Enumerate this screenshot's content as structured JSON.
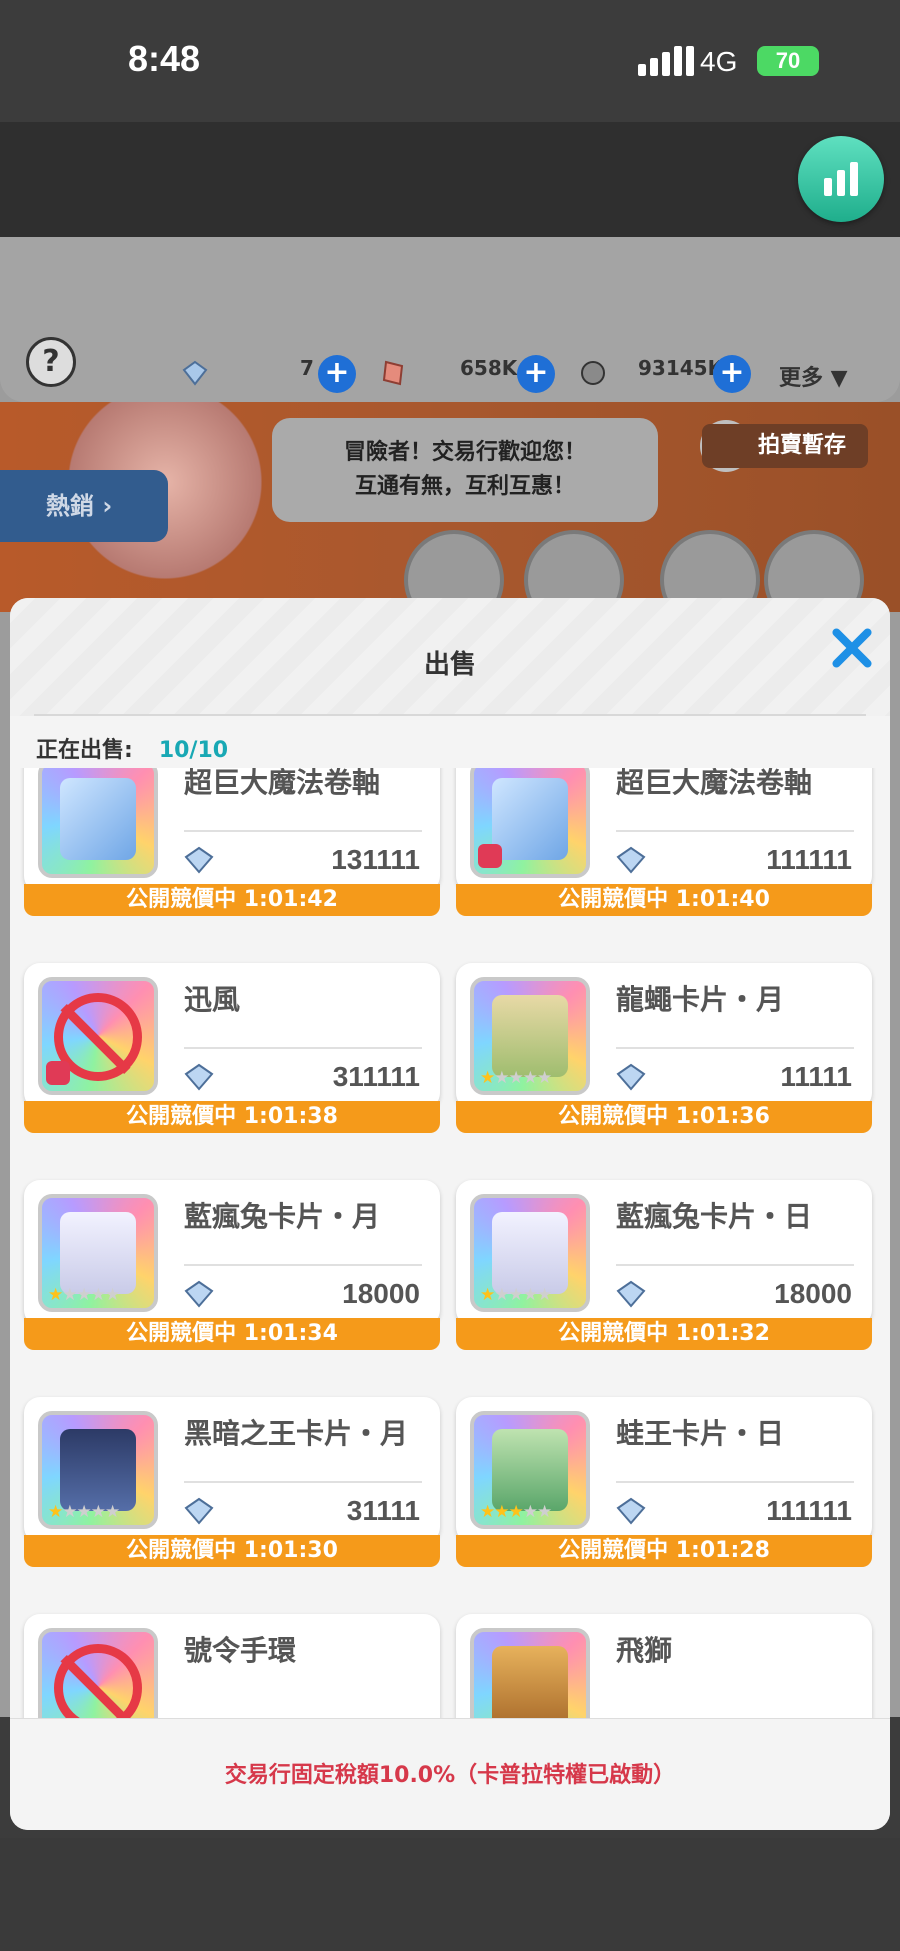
{
  "status_bar": {
    "time": "8:48",
    "network": "4G",
    "battery": "70"
  },
  "currency": {
    "gem_count": "7",
    "crystal_count": "658K",
    "zeny_count": "93145K",
    "more_label": "更多"
  },
  "npc": {
    "speech": "冒險者！交易行歡迎您！\n互通有無，互利互惠！"
  },
  "auction_label": "拍賣暫存",
  "hot_label": "熱銷",
  "modal": {
    "title": "出售",
    "selling_label": "正在出售:",
    "selling_count": "10/10",
    "tax_notice": "交易行固定稅額10.0%（卡普拉特權已啟動）"
  },
  "items": [
    {
      "name": "超巨大魔法卷軸",
      "price": "131111",
      "status": "公開競價中 1:01:42",
      "locked": false,
      "stars": 0,
      "art": "scroll"
    },
    {
      "name": "超巨大魔法卷軸",
      "price": "111111",
      "status": "公開競價中 1:01:40",
      "locked": true,
      "stars": 0,
      "art": "scroll"
    },
    {
      "name": "迅風",
      "price": "311111",
      "status": "公開競價中 1:01:38",
      "locked": true,
      "stars": 0,
      "art": "forbidden"
    },
    {
      "name": "龍蠅卡片・月",
      "price": "11111",
      "status": "公開競價中 1:01:36",
      "locked": false,
      "stars": 1,
      "art": "card-fly"
    },
    {
      "name": "藍瘋兔卡片・月",
      "price": "18000",
      "status": "公開競價中 1:01:34",
      "locked": false,
      "stars": 1,
      "art": "card-rabbit"
    },
    {
      "name": "藍瘋兔卡片・日",
      "price": "18000",
      "status": "公開競價中 1:01:32",
      "locked": false,
      "stars": 1,
      "art": "card-rabbit"
    },
    {
      "name": "黑暗之王卡片・月",
      "price": "31111",
      "status": "公開競價中 1:01:30",
      "locked": false,
      "stars": 1,
      "art": "card-dark"
    },
    {
      "name": "蛙王卡片・日",
      "price": "111111",
      "status": "公開競價中 1:01:28",
      "locked": false,
      "stars": 3,
      "art": "card-frog"
    },
    {
      "name": "號令手環",
      "price": "",
      "status": "",
      "locked": false,
      "stars": 0,
      "art": "forbidden"
    },
    {
      "name": "飛獅",
      "price": "",
      "status": "",
      "locked": false,
      "stars": 0,
      "art": "lion"
    }
  ],
  "colors": {
    "accent_blue": "#1e90e6",
    "timer_orange": "#f59a1a",
    "tax_red": "#d6384a",
    "count_teal": "#18a8b4"
  }
}
